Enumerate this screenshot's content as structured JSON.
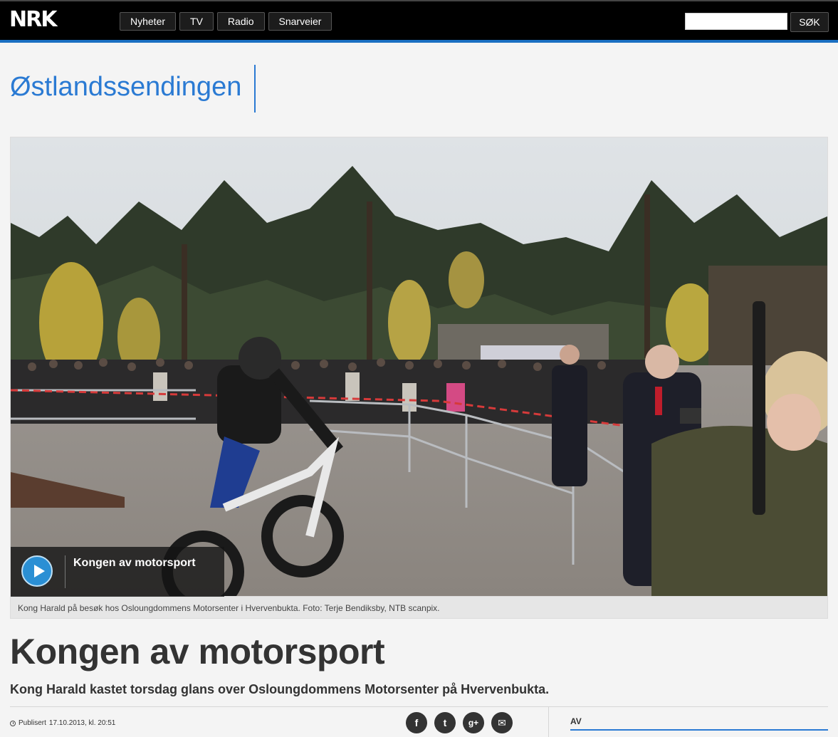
{
  "header": {
    "logo_text": "NRK",
    "nav": [
      {
        "label": "Nyheter"
      },
      {
        "label": "TV"
      },
      {
        "label": "Radio"
      },
      {
        "label": "Snarveier"
      }
    ],
    "search_placeholder": "",
    "search_button": "SØK"
  },
  "section": {
    "title": "Østlandssendingen"
  },
  "hero": {
    "video_title": "Kongen av motorsport",
    "caption": "Kong Harald på besøk hos Osloungdommens Motorsenter i Hvervenbukta. Foto: Terje Bendiksby, NTB scanpix."
  },
  "article": {
    "headline": "Kongen av motorsport",
    "lead": "Kong Harald kastet torsdag glans over Osloungdommens Motorsenter på Hvervenbukta.",
    "published_label": "Publisert",
    "published_date": "17.10.2013, kl. 20:51",
    "share": [
      {
        "icon": "facebook-icon",
        "glyph": "f"
      },
      {
        "icon": "twitter-icon",
        "glyph": "t"
      },
      {
        "icon": "google-plus-icon",
        "glyph": "g+"
      },
      {
        "icon": "email-icon",
        "glyph": "✉"
      }
    ],
    "author_heading": "AV"
  },
  "colors": {
    "accent": "#2a7ad3",
    "topbar": "#000000",
    "play": "#2a8fd4"
  }
}
